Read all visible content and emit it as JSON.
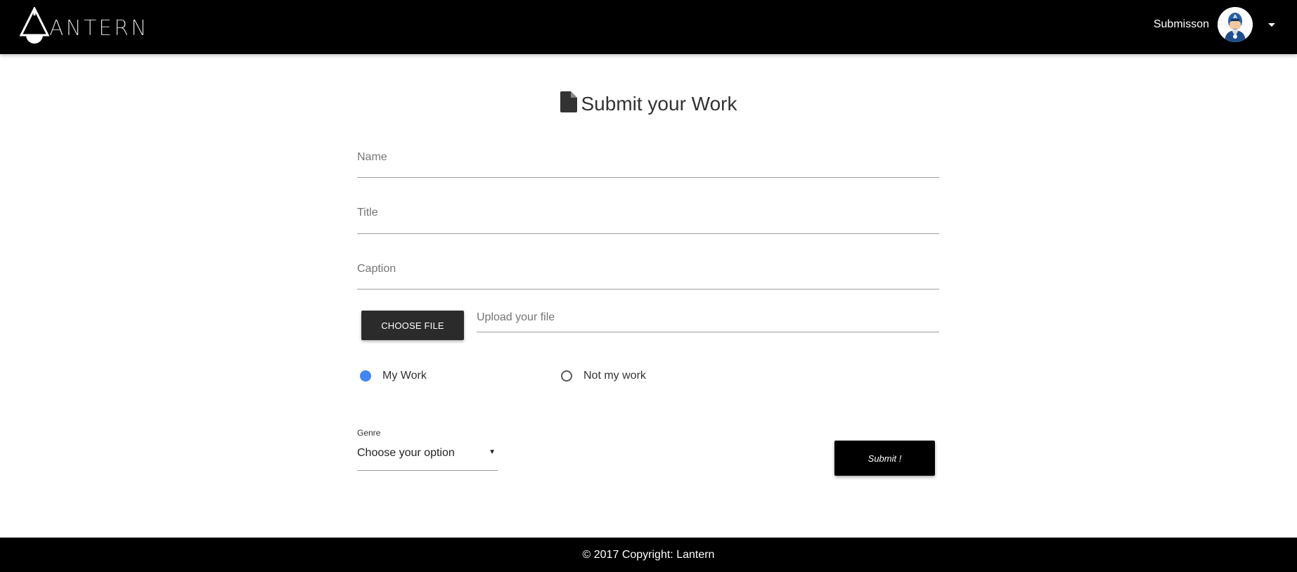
{
  "header": {
    "logo_text": "ANTERN",
    "user_name": "Submisson",
    "icons": {
      "logo": "lantern-logo-icon",
      "avatar": "user-avatar",
      "menu": "caret-down-icon"
    }
  },
  "form": {
    "title": "Submit your Work",
    "title_icon": "document-icon",
    "name_label": "Name",
    "title_label": "Title",
    "caption_label": "Caption",
    "file_button_label": "CHOOSE FILE",
    "file_placeholder": "Upload your file",
    "ownership": {
      "options": [
        {
          "label": "My Work",
          "checked": true
        },
        {
          "label": "Not my work",
          "checked": false
        }
      ]
    },
    "genre": {
      "label": "Genre",
      "selected": "Choose your option"
    },
    "submit_label": "Submit !"
  },
  "footer": {
    "text": "© 2017 Copyright: Lantern"
  },
  "colors": {
    "header_bg": "#000000",
    "radio_checked": "#4285f4",
    "button_dark": "#2b2b2b"
  }
}
